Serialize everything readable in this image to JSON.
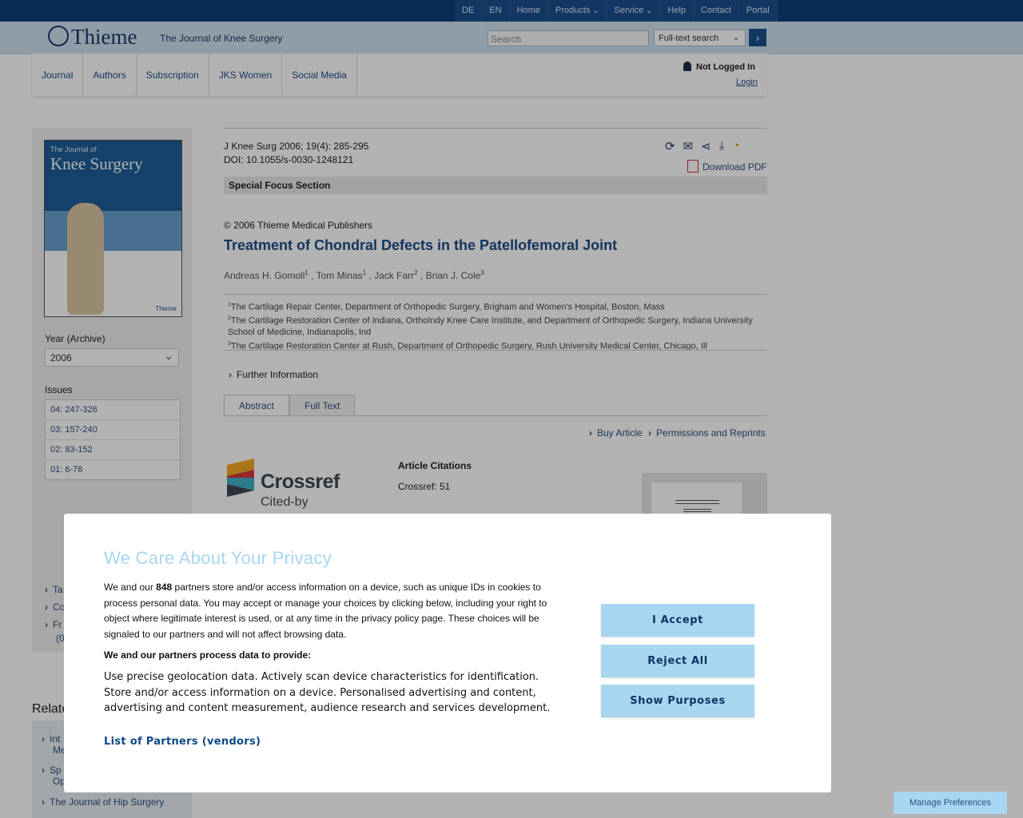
{
  "topnav": {
    "items": [
      "DE",
      "EN",
      "Home",
      "Products",
      "Service",
      "Help",
      "Contact",
      "Portal"
    ]
  },
  "brand": {
    "logo": "Thieme",
    "journal": "The Journal of Knee Surgery"
  },
  "search": {
    "placeholder": "Search",
    "type": "Full-text search",
    "go": "›"
  },
  "mainnav": {
    "items": [
      "Journal",
      "Authors",
      "Subscription",
      "JKS Women",
      "Social Media"
    ]
  },
  "account": {
    "status": "Not Logged In",
    "login": "Login"
  },
  "sidebar": {
    "cover_line1": "The Journal of",
    "cover_line2": "Knee Surgery",
    "cover_pub": "Thieme",
    "year_label": "Year (Archive)",
    "year_value": "2006",
    "issues_label": "Issues",
    "issues": [
      "04: 247-326",
      "03: 157-240",
      "02: 83-152",
      "01: 6-76"
    ],
    "links": [
      "Ta",
      "Co",
      "Fr",
      "(0"
    ]
  },
  "related": {
    "title": "Relate",
    "items": [
      "Int",
      "Me",
      "Sp",
      "Op",
      "The Journal of Hip Surgery"
    ]
  },
  "article": {
    "citation": "J Knee Surg 2006; 19(4): 285-295",
    "doi": "DOI: 10.1055/s-0030-1248121",
    "download": "Download PDF",
    "section": "Special Focus Section",
    "copyright": "© 2006 Thieme Medical Publishers",
    "title": "Treatment of Chondral Defects in the Patellofemoral Joint",
    "authors": [
      {
        "name": "Andreas H. Gomoll",
        "sup": "1"
      },
      {
        "name": "Tom Minas",
        "sup": "1"
      },
      {
        "name": "Jack Farr",
        "sup": "2"
      },
      {
        "name": "Brian J. Cole",
        "sup": "3"
      }
    ],
    "affiliations": [
      {
        "sup": "1",
        "text": "The Cartilage Repair Center, Department of Orthopedic Surgery, Brigham and Women's Hospital, Boston, Mass"
      },
      {
        "sup": "2",
        "text": "The Cartilage Restoration Center of Indiana, OrthoIndy Knee Care Institute, and Department of Orthopedic Surgery, Indiana University School of Medicine, Indianapolis, Ind"
      },
      {
        "sup": "3",
        "text": "The Cartilage Restoration Center at Rush, Department of Orthopedic Surgery, Rush University Medical Center, Chicago, Ill"
      }
    ],
    "further": "Further Information",
    "tabs": [
      "Abstract",
      "Full Text"
    ],
    "buy": "Buy Article",
    "permissions": "Permissions and Reprints",
    "crossref_word": "Crossref",
    "crossref_sub": "Cited-by",
    "citations_title": "Article Citations",
    "citations_count": "Crossref: 51"
  },
  "privacy": {
    "title": "We Care About Your Privacy",
    "body_pre": "We and our ",
    "partners_count": "848",
    "body_post": " partners store and/or access information on a device, such as unique IDs in cookies to process personal data. You may accept or manage your choices by clicking below, including your right to object where legitimate interest is used, or at any time in the privacy policy page. These choices will be signaled to our partners and will not affect browsing data.",
    "subtitle": "We and our partners process data to provide:",
    "purposes": "Use precise geolocation data. Actively scan device characteristics for identification. Store and/or access information on a device. Personalised advertising and content, advertising and content measurement, audience research and services development.",
    "partners_link": "List of Partners (vendors)",
    "accept": "I Accept",
    "reject": "Reject All",
    "purposes_btn": "Show Purposes"
  },
  "manage_prefs": "Manage Preferences",
  "colors": {
    "navy": "#0f3e78",
    "link": "#2a4d80",
    "consent_accent": "#a8d6f0"
  }
}
